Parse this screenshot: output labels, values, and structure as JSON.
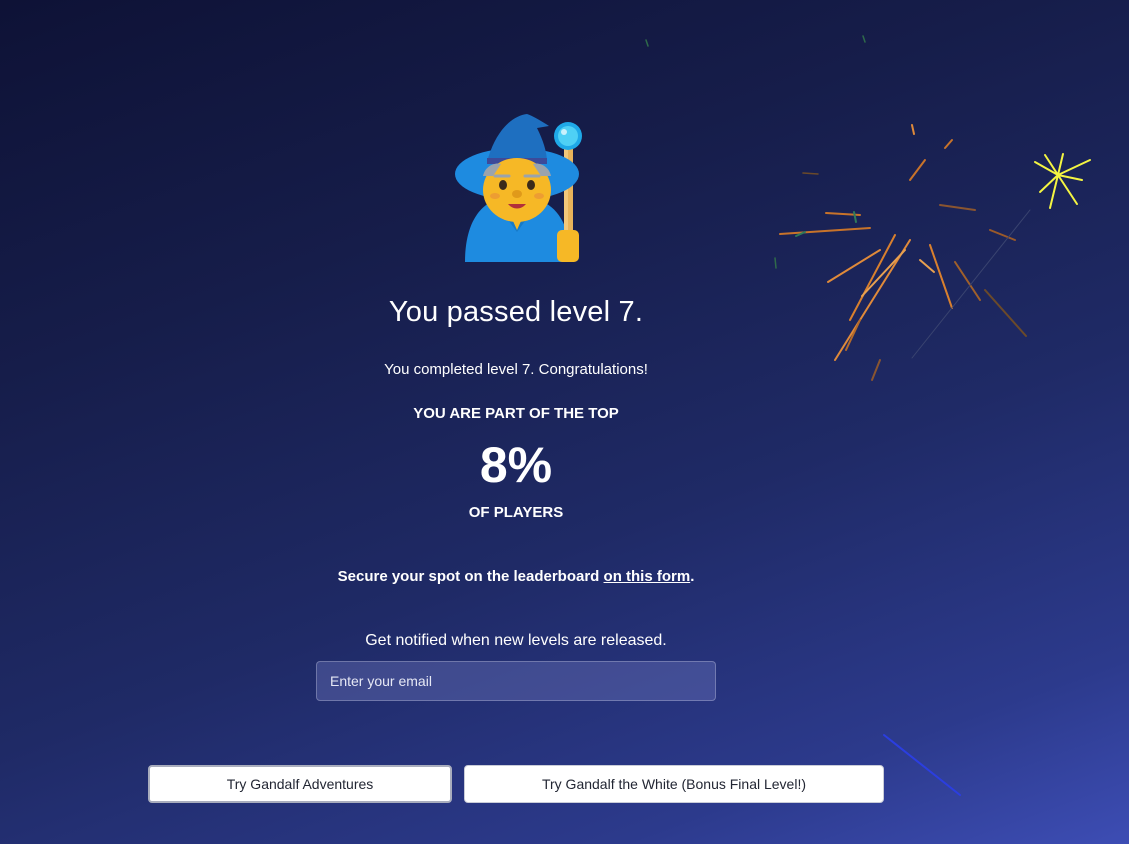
{
  "result": {
    "wizard_icon": "wizard-emoji-icon",
    "title": "You passed level 7.",
    "subtitle": "You completed level 7. Congratulations!",
    "top_label": "YOU ARE PART OF THE TOP",
    "percent": "8%",
    "players_label": "OF PLAYERS"
  },
  "leaderboard": {
    "text": "Secure your spot on the leaderboard ",
    "link_label": "on this form",
    "suffix": "."
  },
  "notify": {
    "text": "Get notified when new levels are released.",
    "email_placeholder": "Enter your email",
    "email_value": ""
  },
  "buttons": {
    "adventures_label": "Try Gandalf Adventures",
    "white_label": "Try Gandalf the White (Bonus Final Level!)"
  },
  "colors": {
    "background_top": "#0e1236",
    "background_bottom": "#3d4db4",
    "firework_orange": "#e08a3a",
    "firework_yellow": "#f4f542"
  }
}
